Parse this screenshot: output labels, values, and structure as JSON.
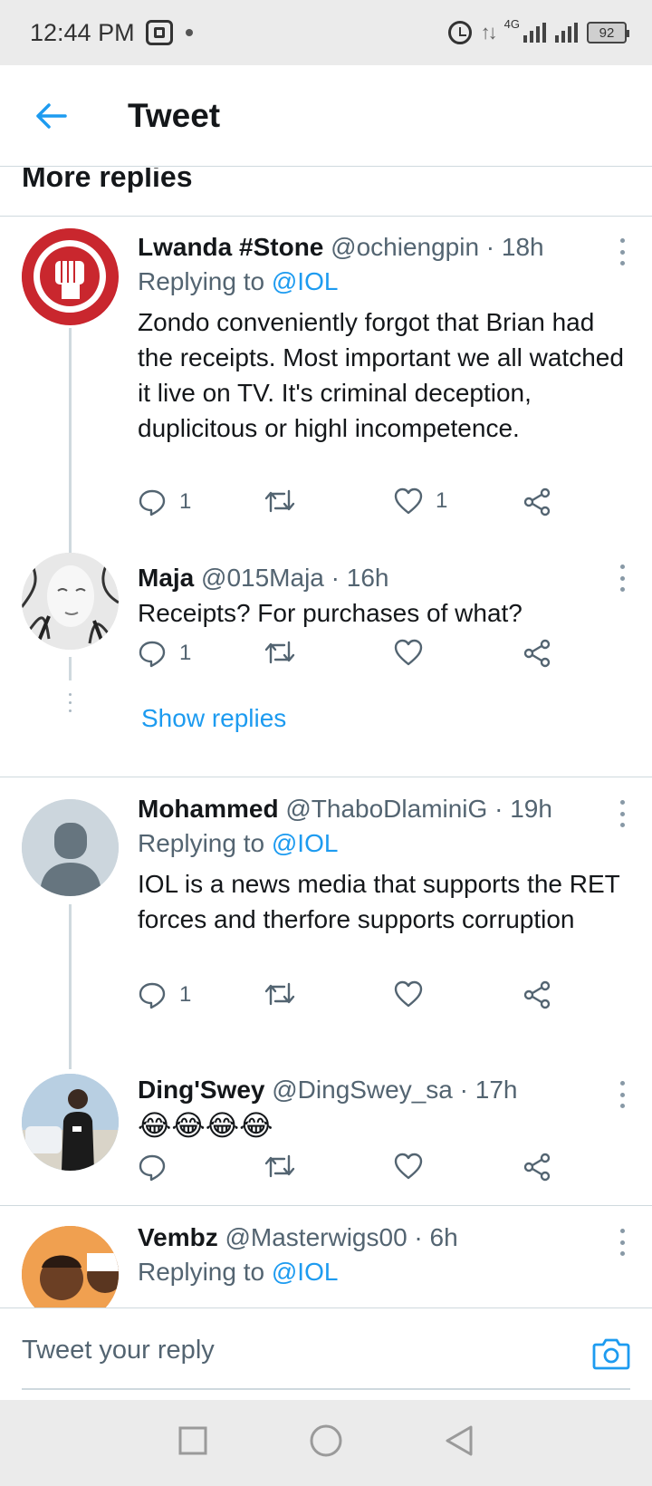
{
  "status_bar": {
    "time": "12:44 PM",
    "network": "4G",
    "battery": "92"
  },
  "header": {
    "title": "Tweet"
  },
  "section": {
    "title": "More replies"
  },
  "tweets": [
    {
      "name": "Lwanda #Stone",
      "handle": "@ochiengpin · 18h",
      "replying_prefix": "Replying to ",
      "replying_to": "@IOL",
      "text": "Zondo conveniently forgot that Brian had the receipts. Most important we all watched it live on TV. It's criminal deception, duplicitous or highl incompetence.",
      "reply_count": "1",
      "retweet_count": "",
      "like_count": "1"
    },
    {
      "name": "Maja",
      "handle": "@015Maja · 16h",
      "text": "Receipts? For purchases of what?",
      "reply_count": "1",
      "retweet_count": "",
      "like_count": "",
      "show_replies": "Show replies"
    },
    {
      "name": "Mohammed",
      "handle": "@ThaboDlaminiG · 19h",
      "replying_prefix": "Replying to ",
      "replying_to": "@IOL",
      "text": "IOL is a news media that supports the RET forces and therfore supports corruption",
      "reply_count": "1",
      "retweet_count": "",
      "like_count": ""
    },
    {
      "name": "Ding'Swey",
      "handle": "@DingSwey_sa · 17h",
      "text": "😂😂😂😂",
      "reply_count": "",
      "retweet_count": "",
      "like_count": ""
    },
    {
      "name": "Vembz",
      "handle": "@Masterwigs00 · 6h",
      "replying_prefix": "Replying to ",
      "replying_to": "@IOL"
    }
  ],
  "composer": {
    "placeholder": "Tweet your reply"
  },
  "colors": {
    "accent": "#1d9bf0",
    "muted": "#536471",
    "divider": "#cfd9de"
  }
}
